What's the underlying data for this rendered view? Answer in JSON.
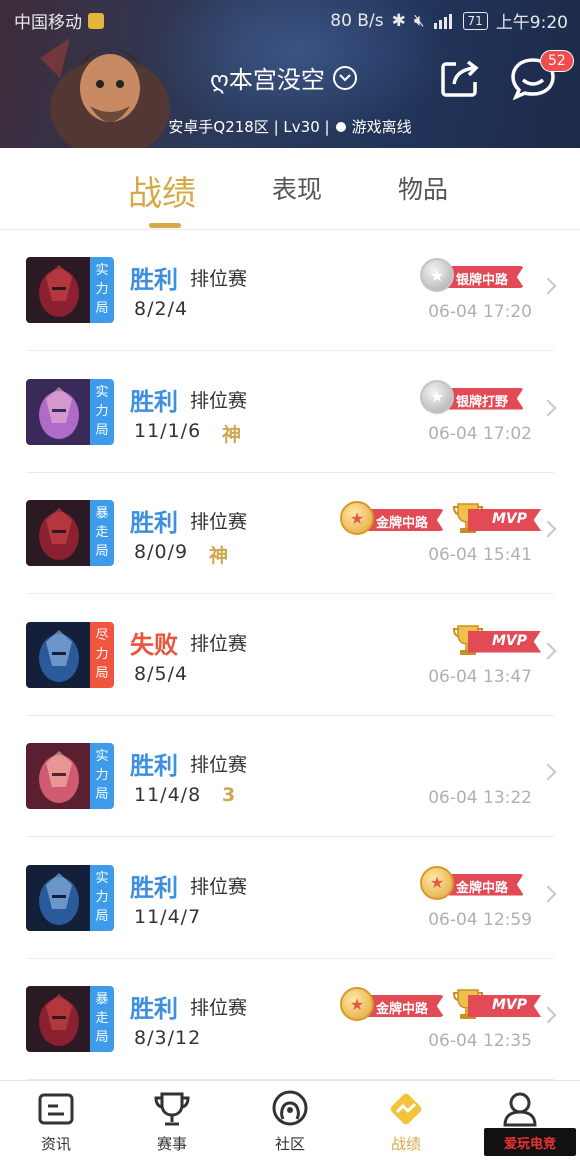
{
  "status_bar": {
    "carrier": "中国移动",
    "speed": "80 B/s",
    "battery": "71",
    "time": "上午9:20"
  },
  "header": {
    "player_name": "ღ本宫没空",
    "message_count": "52",
    "server_info": "安卓手Q218区 | Lv30 |",
    "online_status": "游戏离线"
  },
  "tabs": [
    {
      "label": "战绩",
      "active": true
    },
    {
      "label": "表现",
      "active": false
    },
    {
      "label": "物品",
      "active": false
    }
  ],
  "matches": [
    {
      "mode": "实力局",
      "mode_color": "blue",
      "result": "胜利",
      "outcome": "win",
      "type": "排位赛",
      "kda": "8/2/4",
      "honor": "",
      "badges": [
        {
          "kind": "silver",
          "label": "银牌中路"
        }
      ],
      "datetime": "06-04 17:20",
      "hero": "dark-red"
    },
    {
      "mode": "实力局",
      "mode_color": "blue",
      "result": "胜利",
      "outcome": "win",
      "type": "排位赛",
      "kda": "11/1/6",
      "honor": "神",
      "badges": [
        {
          "kind": "silver",
          "label": "银牌打野"
        }
      ],
      "datetime": "06-04 17:02",
      "hero": "purple"
    },
    {
      "mode": "暴走局",
      "mode_color": "blue",
      "result": "胜利",
      "outcome": "win",
      "type": "排位赛",
      "kda": "8/0/9",
      "honor": "神",
      "badges": [
        {
          "kind": "gold",
          "label": "金牌中路"
        },
        {
          "kind": "mvp",
          "label": "MVP"
        }
      ],
      "datetime": "06-04 15:41",
      "hero": "dark-red"
    },
    {
      "mode": "尽力局",
      "mode_color": "red",
      "result": "失败",
      "outcome": "lose",
      "type": "排位赛",
      "kda": "8/5/4",
      "honor": "",
      "badges": [
        {
          "kind": "mvp",
          "label": "MVP"
        }
      ],
      "datetime": "06-04 13:47",
      "hero": "blue-dark"
    },
    {
      "mode": "实力局",
      "mode_color": "blue",
      "result": "胜利",
      "outcome": "win",
      "type": "排位赛",
      "kda": "11/4/8",
      "honor": "3",
      "badges": [],
      "datetime": "06-04 13:22",
      "hero": "pink"
    },
    {
      "mode": "实力局",
      "mode_color": "blue",
      "result": "胜利",
      "outcome": "win",
      "type": "排位赛",
      "kda": "11/4/7",
      "honor": "",
      "badges": [
        {
          "kind": "gold",
          "label": "金牌中路"
        }
      ],
      "datetime": "06-04 12:59",
      "hero": "blue-dark"
    },
    {
      "mode": "暴走局",
      "mode_color": "blue",
      "result": "胜利",
      "outcome": "win",
      "type": "排位赛",
      "kda": "8/3/12",
      "honor": "",
      "badges": [
        {
          "kind": "gold",
          "label": "金牌中路"
        },
        {
          "kind": "mvp",
          "label": "MVP"
        }
      ],
      "datetime": "06-04 12:35",
      "hero": "dark-red"
    }
  ],
  "bottom_nav": [
    {
      "label": "资讯",
      "icon": "news-icon",
      "active": false
    },
    {
      "label": "赛事",
      "icon": "trophy-icon",
      "active": false
    },
    {
      "label": "社区",
      "icon": "community-icon",
      "active": false
    },
    {
      "label": "战绩",
      "icon": "record-icon",
      "active": true
    },
    {
      "label": "",
      "icon": "profile-icon",
      "active": false
    }
  ],
  "watermark": "爱玩电竞"
}
